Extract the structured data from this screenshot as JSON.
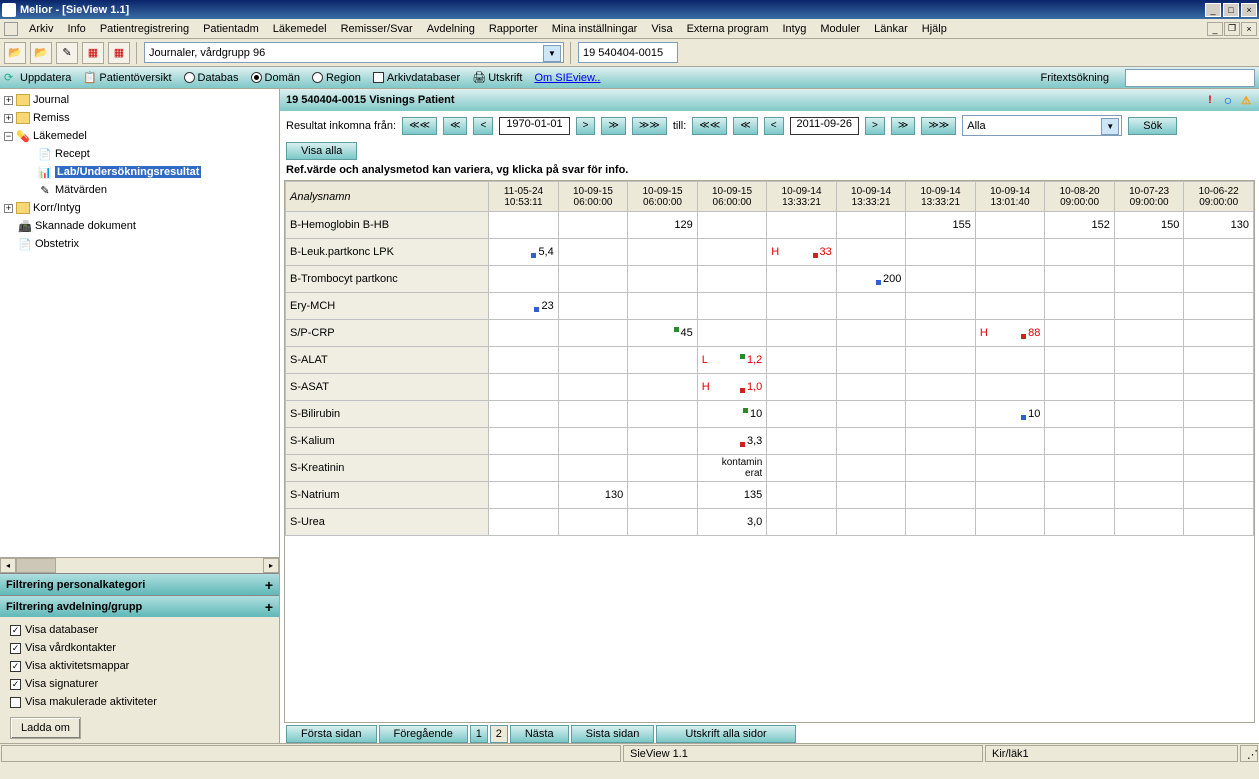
{
  "window": {
    "title": "Melior - [SieView 1.1]"
  },
  "menubar": [
    "Arkiv",
    "Info",
    "Patientregistrering",
    "Patientadm",
    "Läkemedel",
    "Remisser/Svar",
    "Avdelning",
    "Rapporter",
    "Mina inställningar",
    "Visa",
    "Externa program",
    "Intyg",
    "Moduler",
    "Länkar",
    "Hjälp"
  ],
  "toolbar1": {
    "combo1": "Journaler, vårdgrupp 96",
    "field1": "19 540404-0015"
  },
  "toolbar2": {
    "uppdatera": "Uppdatera",
    "patientoversikt": "Patientöversikt",
    "databas": "Databas",
    "doman": "Domän",
    "region": "Region",
    "arkivdatabaser": "Arkivdatabaser",
    "utskrift": "Utskrift",
    "omsieview": "Om SIEview..",
    "fritext": "Fritextsökning"
  },
  "tree": [
    {
      "icon": "folder",
      "label": "Journal",
      "toggle": "+"
    },
    {
      "icon": "folder",
      "label": "Remiss",
      "toggle": "+"
    },
    {
      "icon": "pill",
      "label": "Läkemedel",
      "toggle": "-",
      "children": [
        {
          "icon": "doc",
          "label": "Recept"
        },
        {
          "icon": "chart",
          "label": "Lab/Undersökningsresultat",
          "selected": true
        },
        {
          "icon": "pen",
          "label": "Mätvärden"
        }
      ]
    },
    {
      "icon": "folder",
      "label": "Korr/Intyg",
      "toggle": "+"
    },
    {
      "icon": "scan",
      "label": "Skannade dokument"
    },
    {
      "icon": "doc",
      "label": "Obstetrix"
    }
  ],
  "filters": {
    "personkategori": "Filtrering personalkategori",
    "avdelning": "Filtrering avdelning/grupp",
    "checks": [
      {
        "label": "Visa databaser",
        "checked": true
      },
      {
        "label": "Visa vårdkontakter",
        "checked": true
      },
      {
        "label": "Visa aktivitetsmappar",
        "checked": true
      },
      {
        "label": "Visa signaturer",
        "checked": true
      },
      {
        "label": "Visa makulerade aktiviteter",
        "checked": false
      }
    ],
    "reload": "Ladda om"
  },
  "content": {
    "header": "19 540404-0015 Visnings Patient",
    "datebar": {
      "from_label": "Resultat inkomna från:",
      "nav_first": "≪≪",
      "nav_prev2": "≪",
      "nav_prev": "<",
      "date_from": "1970-01-01",
      "nav_next": ">",
      "nav_next2": "≫",
      "nav_last": "≫≫",
      "to_label": "till:",
      "date_to": "2011-09-26",
      "filter_combo": "Alla",
      "sok": "Sök",
      "visa_alla": "Visa alla"
    },
    "note": "Ref.värde och analysmetod kan variera, vg klicka på svar för info.",
    "columns": [
      "Analysnamn",
      "11-05-24 10:53:11",
      "10-09-15 06:00:00",
      "10-09-15 06:00:00",
      "10-09-15 06:00:00",
      "10-09-14 13:33:21",
      "10-09-14 13:33:21",
      "10-09-14 13:33:21",
      "10-09-14 13:01:40",
      "10-08-20 09:00:00",
      "10-07-23 09:00:00",
      "10-06-22 09:00:00"
    ],
    "rows": [
      {
        "name": "B-Hemoglobin B-HB",
        "cells": [
          "",
          "",
          "129",
          "",
          "",
          "",
          "155",
          "",
          "152",
          "150",
          "130"
        ]
      },
      {
        "name": "B-Leuk.partkonc LPK",
        "cells": [
          "5,4",
          "",
          "",
          "",
          "33",
          "",
          "",
          "",
          "",
          "",
          ""
        ],
        "flags": {
          "4": "H"
        },
        "markers": {
          "0": "b",
          "4": "r"
        }
      },
      {
        "name": "B-Trombocyt partkonc",
        "cells": [
          "",
          "",
          "",
          "",
          "",
          "200",
          "",
          "",
          "",
          "",
          ""
        ],
        "markers": {
          "5": "b"
        }
      },
      {
        "name": "Ery-MCH",
        "cells": [
          "23",
          "",
          "",
          "",
          "",
          "",
          "",
          "",
          "",
          "",
          ""
        ],
        "markers": {
          "0": "b"
        }
      },
      {
        "name": "S/P-CRP",
        "cells": [
          "",
          "",
          "45",
          "",
          "",
          "",
          "",
          "88",
          "",
          "",
          ""
        ],
        "flags": {
          "7": "H"
        },
        "markers": {
          "2": "g",
          "7": "r"
        }
      },
      {
        "name": "S-ALAT",
        "cells": [
          "",
          "",
          "",
          "1,2",
          "",
          "",
          "",
          "",
          "",
          "",
          ""
        ],
        "flags": {
          "3": "L"
        },
        "markers": {
          "3": "g"
        }
      },
      {
        "name": "S-ASAT",
        "cells": [
          "",
          "",
          "",
          "1,0",
          "",
          "",
          "",
          "",
          "",
          "",
          ""
        ],
        "flags": {
          "3": "H"
        },
        "markers": {
          "3": "r"
        }
      },
      {
        "name": "S-Bilirubin",
        "cells": [
          "",
          "",
          "",
          "10",
          "",
          "",
          "",
          "10",
          "",
          "",
          ""
        ],
        "markers": {
          "3": "g",
          "7": "b"
        }
      },
      {
        "name": "S-Kalium",
        "cells": [
          "",
          "",
          "",
          "3,3",
          "",
          "",
          "",
          "",
          "",
          "",
          ""
        ],
        "markers": {
          "3": "r"
        }
      },
      {
        "name": "S-Kreatinin",
        "cells": [
          "",
          "",
          "",
          "kontamin erat",
          "",
          "",
          "",
          "",
          "",
          "",
          ""
        ]
      },
      {
        "name": "S-Natrium",
        "cells": [
          "",
          "130",
          "",
          "135",
          "",
          "",
          "",
          "",
          "",
          "",
          ""
        ]
      },
      {
        "name": "S-Urea",
        "cells": [
          "",
          "",
          "",
          "3,0",
          "",
          "",
          "",
          "",
          "",
          "",
          ""
        ]
      }
    ],
    "pager": {
      "first": "Första sidan",
      "prev": "Föregående",
      "p1": "1",
      "p2": "2",
      "next": "Nästa",
      "last": "Sista sidan",
      "print": "Utskrift alla sidor"
    }
  },
  "statusbar": {
    "center": "SieView 1.1",
    "right": "Kir/läk1"
  }
}
